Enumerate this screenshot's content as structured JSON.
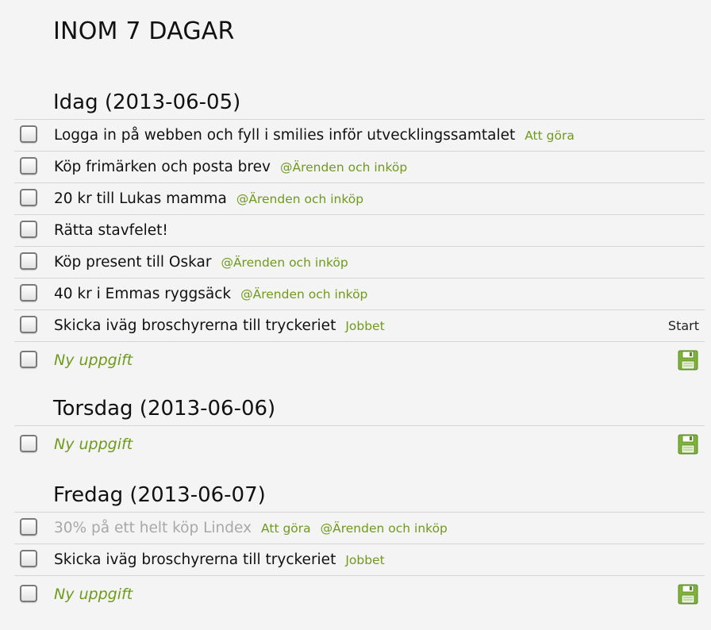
{
  "page": {
    "title": "INOM 7 DAGAR"
  },
  "colors": {
    "tag": "#6f9a1b",
    "done_text": "#a8a8a8",
    "background": "#f4f4f4",
    "save_icon": "#7fb33a"
  },
  "sections": [
    {
      "heading": "Idag (2013-06-05)",
      "tasks": [
        {
          "text": "Logga in på webben och fyll i smilies inför utvecklingssamtalet",
          "tags": [
            "Att göra"
          ],
          "done": false
        },
        {
          "text": "Köp frimärken och posta brev",
          "tags": [
            "@Ärenden och inköp"
          ],
          "done": false
        },
        {
          "text": "20 kr till Lukas mamma",
          "tags": [
            "@Ärenden och inköp"
          ],
          "done": false
        },
        {
          "text": "Rätta stavfelet!",
          "tags": [],
          "done": false
        },
        {
          "text": "Köp present till Oskar",
          "tags": [
            "@Ärenden och inköp"
          ],
          "done": false
        },
        {
          "text": "40 kr i Emmas ryggsäck",
          "tags": [
            "@Ärenden och inköp"
          ],
          "done": false
        },
        {
          "text": "Skicka iväg broschyrerna till tryckeriet",
          "tags": [
            "Jobbet"
          ],
          "done": false,
          "right_label": "Start"
        }
      ],
      "new_task_placeholder": "Ny uppgift"
    },
    {
      "heading": "Torsdag (2013-06-06)",
      "tasks": [],
      "new_task_placeholder": "Ny uppgift"
    },
    {
      "heading": "Fredag (2013-06-07)",
      "tasks": [
        {
          "text": "30% på ett helt köp Lindex",
          "tags": [
            "Att göra",
            "@Ärenden och inköp"
          ],
          "done": true
        },
        {
          "text": "Skicka iväg broschyrerna till tryckeriet",
          "tags": [
            "Jobbet"
          ],
          "done": false
        }
      ],
      "new_task_placeholder": "Ny uppgift"
    }
  ]
}
